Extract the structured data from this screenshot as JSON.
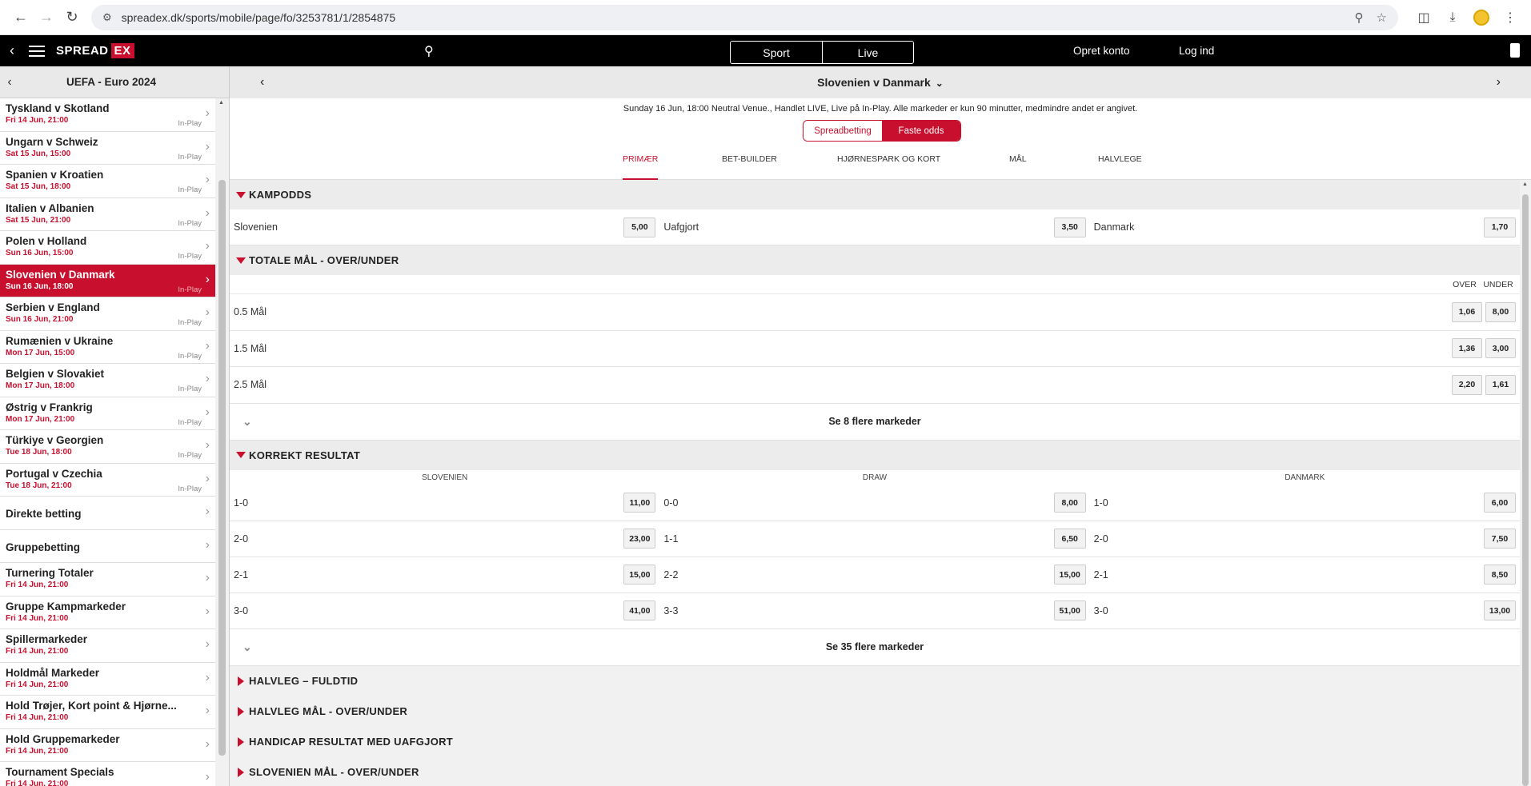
{
  "browser": {
    "url": "spreadex.dk/sports/mobile/page/fo/3253781/1/2854875"
  },
  "header": {
    "logo_left": "SPREAD",
    "logo_right": "EX",
    "sport_label": "Sport",
    "live_label": "Live",
    "create_account": "Opret konto",
    "login": "Log ind"
  },
  "sidebar": {
    "title": "UEFA - Euro 2024",
    "items": [
      {
        "name": "Tyskland v Skotland",
        "date": "Fri 14 Jun, 21:00",
        "tag": "In-Play"
      },
      {
        "name": "Ungarn v Schweiz",
        "date": "Sat 15 Jun, 15:00",
        "tag": "In-Play"
      },
      {
        "name": "Spanien v Kroatien",
        "date": "Sat 15 Jun, 18:00",
        "tag": "In-Play"
      },
      {
        "name": "Italien v Albanien",
        "date": "Sat 15 Jun, 21:00",
        "tag": "In-Play"
      },
      {
        "name": "Polen v Holland",
        "date": "Sun 16 Jun, 15:00",
        "tag": "In-Play"
      },
      {
        "name": "Slovenien v Danmark",
        "date": "Sun 16 Jun, 18:00",
        "tag": "In-Play"
      },
      {
        "name": "Serbien v England",
        "date": "Sun 16 Jun, 21:00",
        "tag": "In-Play"
      },
      {
        "name": "Rumænien v Ukraine",
        "date": "Mon 17 Jun, 15:00",
        "tag": "In-Play"
      },
      {
        "name": "Belgien v Slovakiet",
        "date": "Mon 17 Jun, 18:00",
        "tag": "In-Play"
      },
      {
        "name": "Østrig v Frankrig",
        "date": "Mon 17 Jun, 21:00",
        "tag": "In-Play"
      },
      {
        "name": "Türkiye v Georgien",
        "date": "Tue 18 Jun, 18:00",
        "tag": "In-Play"
      },
      {
        "name": "Portugal v Czechia",
        "date": "Tue 18 Jun, 21:00",
        "tag": "In-Play"
      },
      {
        "name": "Direkte betting"
      },
      {
        "name": "Gruppebetting"
      },
      {
        "name": "Turnering Totaler",
        "date": "Fri 14 Jun, 21:00"
      },
      {
        "name": "Gruppe Kampmarkeder",
        "date": "Fri 14 Jun, 21:00"
      },
      {
        "name": "Spillermarkeder",
        "date": "Fri 14 Jun, 21:00"
      },
      {
        "name": "Holdmål Markeder",
        "date": "Fri 14 Jun, 21:00"
      },
      {
        "name": "Hold Trøjer, Kort point & Hjørne...",
        "date": "Fri 14 Jun, 21:00"
      },
      {
        "name": "Hold Gruppemarkeder",
        "date": "Fri 14 Jun, 21:00"
      },
      {
        "name": "Tournament Specials",
        "date": "Fri 14 Jun, 21:00"
      }
    ]
  },
  "event": {
    "title": "Slovenien v Danmark",
    "info": "Sunday 16 Jun, 18:00 Neutral Venue., Handlet LIVE, Live på In-Play. Alle markeder er kun 90 minutter, medmindre andet er angivet.",
    "toggle_spread": "Spreadbetting",
    "toggle_fixed": "Faste odds",
    "tabs": [
      "PRIMÆR",
      "BET-BUILDER",
      "HJØRNESPARK OG KORT",
      "MÅL",
      "HALVLEGE"
    ]
  },
  "markets": {
    "kampodds": {
      "title": "KAMPODDS",
      "home": "Slovenien",
      "home_odd": "5,00",
      "draw": "Uafgjort",
      "draw_odd": "3,50",
      "away": "Danmark",
      "away_odd": "1,70"
    },
    "totals": {
      "title": "TOTALE MÅL - OVER/UNDER",
      "over": "OVER",
      "under": "UNDER",
      "rows": [
        {
          "label": "0.5 Mål",
          "over": "1,06",
          "under": "8,00"
        },
        {
          "label": "1.5 Mål",
          "over": "1,36",
          "under": "3,00"
        },
        {
          "label": "2.5 Mål",
          "over": "2,20",
          "under": "1,61"
        }
      ],
      "more": "Se 8 flere markeder"
    },
    "correct_score": {
      "title": "KORREKT RESULTAT",
      "col1": "SLOVENIEN",
      "col2": "DRAW",
      "col3": "DANMARK",
      "rows": [
        {
          "a": "1-0",
          "ao": "11,00",
          "b": "0-0",
          "bo": "8,00",
          "c": "1-0",
          "co": "6,00"
        },
        {
          "a": "2-0",
          "ao": "23,00",
          "b": "1-1",
          "bo": "6,50",
          "c": "2-0",
          "co": "7,50"
        },
        {
          "a": "2-1",
          "ao": "15,00",
          "b": "2-2",
          "bo": "15,00",
          "c": "2-1",
          "co": "8,50"
        },
        {
          "a": "3-0",
          "ao": "41,00",
          "b": "3-3",
          "bo": "51,00",
          "c": "3-0",
          "co": "13,00"
        }
      ],
      "more": "Se 35 flere markeder"
    },
    "collapsed": [
      "HALVLEG – FULDTID",
      "HALVLEG MÅL - OVER/UNDER",
      "HANDICAP RESULTAT MED UAFGJORT",
      "SLOVENIEN MÅL - OVER/UNDER"
    ]
  }
}
